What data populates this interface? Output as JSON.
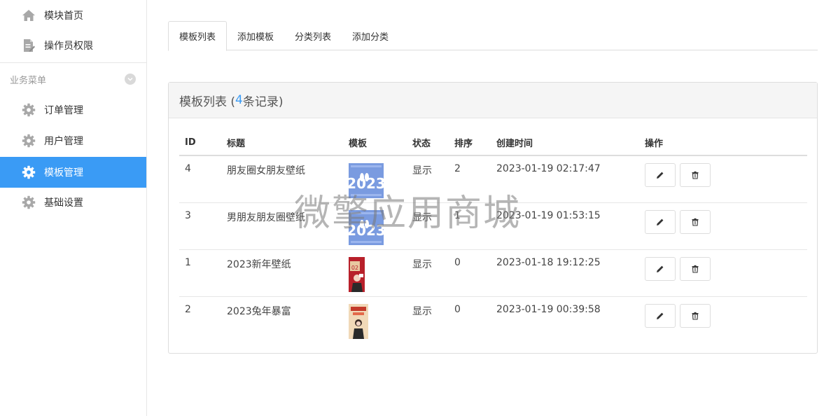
{
  "sidebar": {
    "top_items": [
      {
        "label": "模块首页",
        "icon": "home-icon"
      },
      {
        "label": "操作员权限",
        "icon": "document-edit-icon"
      }
    ],
    "section_title": "业务菜单",
    "items": [
      {
        "label": "订单管理",
        "icon": "gear-icon"
      },
      {
        "label": "用户管理",
        "icon": "gear-icon"
      },
      {
        "label": "模板管理",
        "icon": "gear-icon",
        "active": true
      },
      {
        "label": "基础设置",
        "icon": "gear-icon"
      }
    ]
  },
  "tabs": [
    {
      "label": "模板列表",
      "active": true
    },
    {
      "label": "添加模板"
    },
    {
      "label": "分类列表"
    },
    {
      "label": "添加分类"
    }
  ],
  "panel": {
    "title_prefix": "模板列表 (",
    "count": "4",
    "title_suffix": "条记录)"
  },
  "table": {
    "headers": [
      "ID",
      "标题",
      "模板",
      "状态",
      "排序",
      "创建时间",
      "操作"
    ],
    "rows": [
      {
        "id": "4",
        "title": "朋友圈女朋友壁纸",
        "status": "显示",
        "sort": "2",
        "created": "2023-01-19 02:17:47"
      },
      {
        "id": "3",
        "title": "男朋友朋友圈壁纸",
        "status": "显示",
        "sort": "1",
        "created": "2023-01-19 01:53:15"
      },
      {
        "id": "1",
        "title": "2023新年壁纸",
        "status": "显示",
        "sort": "0",
        "created": "2023-01-18 19:12:25"
      },
      {
        "id": "2",
        "title": "2023兔年暴富",
        "status": "显示",
        "sort": "0",
        "created": "2023-01-19 00:39:58"
      }
    ]
  },
  "watermark": "微擎应用商城",
  "colors": {
    "accent": "#3a9bf5",
    "border": "#dddddd",
    "panel_head": "#f5f5f5"
  }
}
